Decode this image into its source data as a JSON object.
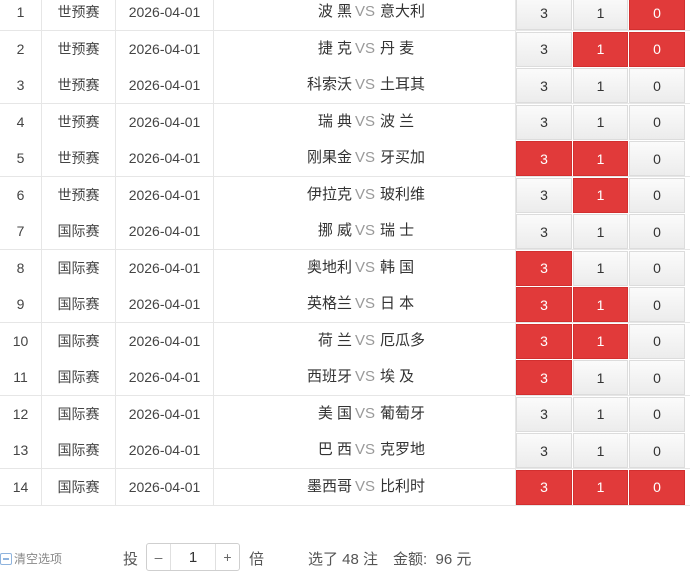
{
  "vs_text": "VS",
  "rows": [
    {
      "no": "1",
      "league": "世预赛",
      "date": "2026-04-01",
      "home": "波 黑",
      "away": "意大利",
      "o3": "3",
      "o1": "1",
      "o0": "0",
      "sel": [
        false,
        false,
        true
      ]
    },
    {
      "no": "2",
      "league": "世预赛",
      "date": "2026-04-01",
      "home": "捷 克",
      "away": "丹 麦",
      "o3": "3",
      "o1": "1",
      "o0": "0",
      "sel": [
        false,
        true,
        true
      ]
    },
    {
      "no": "3",
      "league": "世预赛",
      "date": "2026-04-01",
      "home": "科索沃",
      "away": "土耳其",
      "o3": "3",
      "o1": "1",
      "o0": "0",
      "sel": [
        false,
        false,
        false
      ]
    },
    {
      "no": "4",
      "league": "世预赛",
      "date": "2026-04-01",
      "home": "瑞 典",
      "away": "波 兰",
      "o3": "3",
      "o1": "1",
      "o0": "0",
      "sel": [
        false,
        false,
        false
      ]
    },
    {
      "no": "5",
      "league": "世预赛",
      "date": "2026-04-01",
      "home": "刚果金",
      "away": "牙买加",
      "o3": "3",
      "o1": "1",
      "o0": "0",
      "sel": [
        true,
        true,
        false
      ]
    },
    {
      "no": "6",
      "league": "世预赛",
      "date": "2026-04-01",
      "home": "伊拉克",
      "away": "玻利维",
      "o3": "3",
      "o1": "1",
      "o0": "0",
      "sel": [
        false,
        true,
        false
      ]
    },
    {
      "no": "7",
      "league": "国际赛",
      "date": "2026-04-01",
      "home": "挪 威",
      "away": "瑞 士",
      "o3": "3",
      "o1": "1",
      "o0": "0",
      "sel": [
        false,
        false,
        false
      ]
    },
    {
      "no": "8",
      "league": "国际赛",
      "date": "2026-04-01",
      "home": "奥地利",
      "away": "韩 国",
      "o3": "3",
      "o1": "1",
      "o0": "0",
      "sel": [
        true,
        false,
        false
      ]
    },
    {
      "no": "9",
      "league": "国际赛",
      "date": "2026-04-01",
      "home": "英格兰",
      "away": "日 本",
      "o3": "3",
      "o1": "1",
      "o0": "0",
      "sel": [
        true,
        true,
        false
      ]
    },
    {
      "no": "10",
      "league": "国际赛",
      "date": "2026-04-01",
      "home": "荷 兰",
      "away": "厄瓜多",
      "o3": "3",
      "o1": "1",
      "o0": "0",
      "sel": [
        true,
        true,
        false
      ]
    },
    {
      "no": "11",
      "league": "国际赛",
      "date": "2026-04-01",
      "home": "西班牙",
      "away": "埃 及",
      "o3": "3",
      "o1": "1",
      "o0": "0",
      "sel": [
        true,
        false,
        false
      ]
    },
    {
      "no": "12",
      "league": "国际赛",
      "date": "2026-04-01",
      "home": "美 国",
      "away": "葡萄牙",
      "o3": "3",
      "o1": "1",
      "o0": "0",
      "sel": [
        false,
        false,
        false
      ]
    },
    {
      "no": "13",
      "league": "国际赛",
      "date": "2026-04-01",
      "home": "巴 西",
      "away": "克罗地",
      "o3": "3",
      "o1": "1",
      "o0": "0",
      "sel": [
        false,
        false,
        false
      ]
    },
    {
      "no": "14",
      "league": "国际赛",
      "date": "2026-04-01",
      "home": "墨西哥",
      "away": "比利时",
      "o3": "3",
      "o1": "1",
      "o0": "0",
      "sel": [
        true,
        true,
        true
      ]
    }
  ],
  "footer": {
    "clear_label": "清空选项",
    "bet_label": "投",
    "minus": "–",
    "multiplier": "1",
    "plus": "+",
    "times_label": "倍",
    "summary": "选了 48 注",
    "amount": "金额:  96 元"
  },
  "colors": {
    "selected": "#e13a3a",
    "default": "#f3f3f3"
  }
}
